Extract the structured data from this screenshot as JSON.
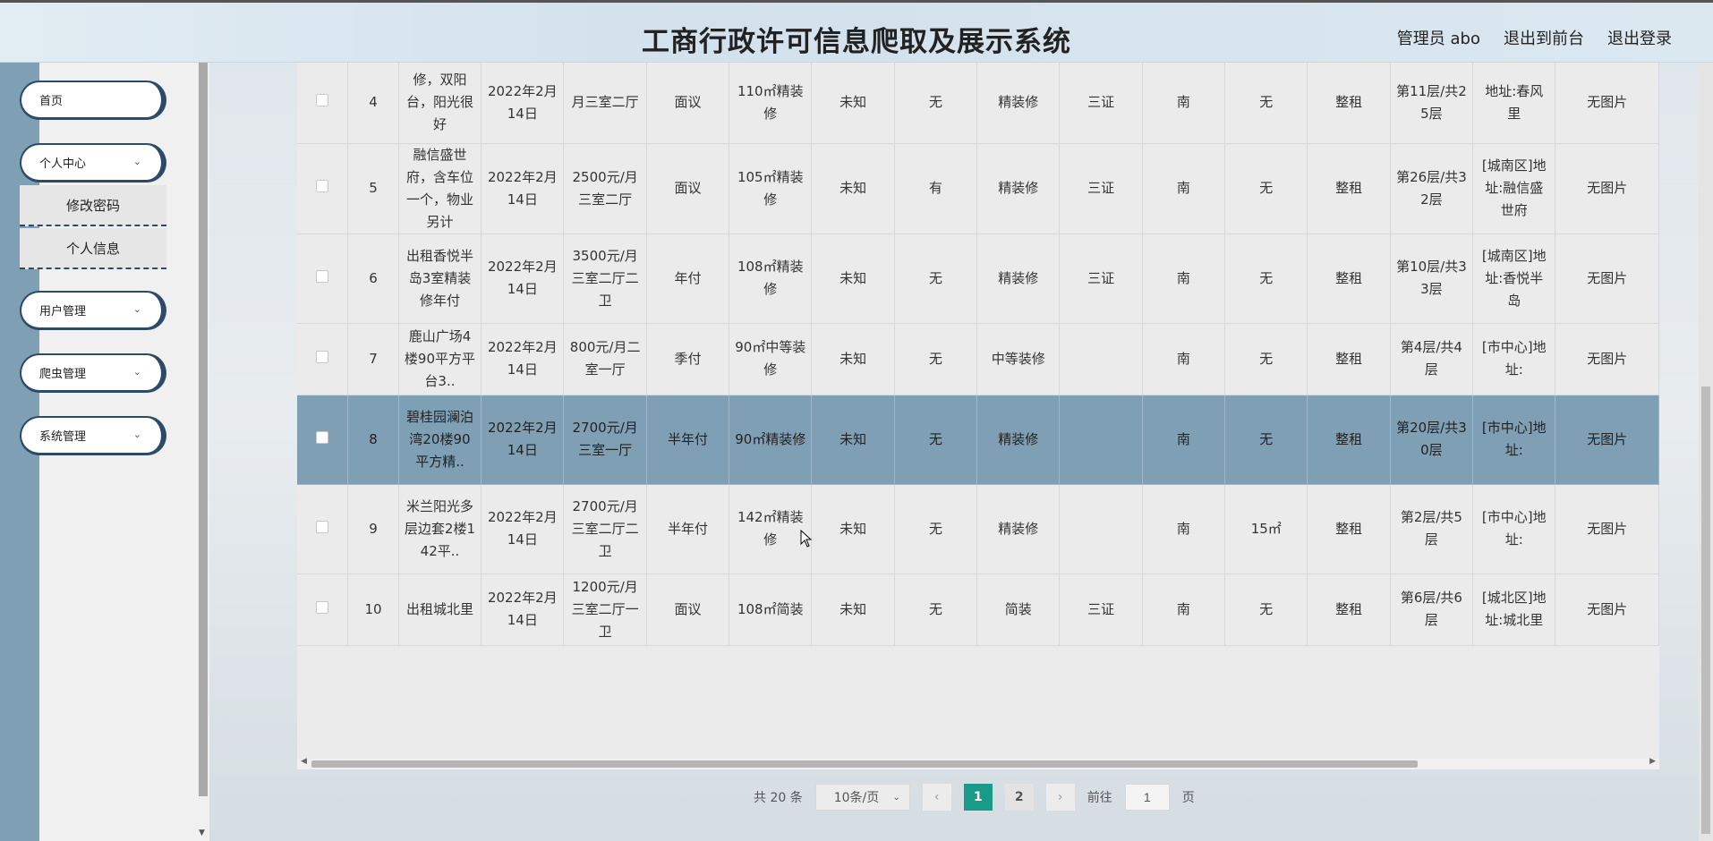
{
  "header": {
    "title": "工商行政许可信息爬取及展示系统",
    "user_label": "管理员 abo",
    "to_front_label": "退出到前台",
    "logout_label": "退出登录"
  },
  "sidebar": {
    "home": "首页",
    "personal_center": "个人中心",
    "change_password": "修改密码",
    "personal_info": "个人信息",
    "user_mgmt": "用户管理",
    "crawler_mgmt": "爬虫管理",
    "system_mgmt": "系统管理"
  },
  "rows": [
    {
      "no": "4",
      "title": "修，双阳台，阳光很好",
      "date": "2022年2月14日",
      "price": "月三室二厅",
      "pay": "面议",
      "area": "110㎡精装修",
      "c1": "未知",
      "c2": "无",
      "deco": "精装修",
      "cert": "三证",
      "dir": "南",
      "c3": "无",
      "rent": "整租",
      "floor": "第11层/共25层",
      "addr": "地址:春风里",
      "img": "无图片"
    },
    {
      "no": "5",
      "title": "融信盛世府，含车位一个，物业另计",
      "date": "2022年2月14日",
      "price": "2500元/月三室二厅",
      "pay": "面议",
      "area": "105㎡精装修",
      "c1": "未知",
      "c2": "有",
      "deco": "精装修",
      "cert": "三证",
      "dir": "南",
      "c3": "无",
      "rent": "整租",
      "floor": "第26层/共32层",
      "addr": "[城南区]地址:融信盛世府",
      "img": "无图片"
    },
    {
      "no": "6",
      "title": "出租香悦半岛3室精装修年付",
      "date": "2022年2月14日",
      "price": "3500元/月三室二厅二卫",
      "pay": "年付",
      "area": "108㎡精装修",
      "c1": "未知",
      "c2": "无",
      "deco": "精装修",
      "cert": "三证",
      "dir": "南",
      "c3": "无",
      "rent": "整租",
      "floor": "第10层/共33层",
      "addr": "[城南区]地址:香悦半岛",
      "img": "无图片"
    },
    {
      "no": "7",
      "title": "鹿山广场4楼90平方平台3..",
      "date": "2022年2月14日",
      "price": "800元/月二室一厅",
      "pay": "季付",
      "area": "90㎡中等装修",
      "c1": "未知",
      "c2": "无",
      "deco": "中等装修",
      "cert": "",
      "dir": "南",
      "c3": "无",
      "rent": "整租",
      "floor": "第4层/共4层",
      "addr": "[市中心]地址:",
      "img": "无图片"
    },
    {
      "no": "8",
      "title": "碧桂园澜泊湾20楼90平方精..",
      "date": "2022年2月14日",
      "price": "2700元/月三室一厅",
      "pay": "半年付",
      "area": "90㎡精装修",
      "c1": "未知",
      "c2": "无",
      "deco": "精装修",
      "cert": "",
      "dir": "南",
      "c3": "无",
      "rent": "整租",
      "floor": "第20层/共30层",
      "addr": "[市中心]地址:",
      "img": "无图片"
    },
    {
      "no": "9",
      "title": "米兰阳光多层边套2楼142平..",
      "date": "2022年2月14日",
      "price": "2700元/月三室二厅二卫",
      "pay": "半年付",
      "area": "142㎡精装修",
      "c1": "未知",
      "c2": "无",
      "deco": "精装修",
      "cert": "",
      "dir": "南",
      "c3": "15㎡",
      "rent": "整租",
      "floor": "第2层/共5层",
      "addr": "[市中心]地址:",
      "img": "无图片"
    },
    {
      "no": "10",
      "title": "出租城北里",
      "date": "2022年2月14日",
      "price": "1200元/月三室二厅一卫",
      "pay": "面议",
      "area": "108㎡简装",
      "c1": "未知",
      "c2": "无",
      "deco": "简装",
      "cert": "三证",
      "dir": "南",
      "c3": "无",
      "rent": "整租",
      "floor": "第6层/共6层",
      "addr": "[城北区]地址:城北里",
      "img": "无图片"
    }
  ],
  "pager": {
    "total": "共 20 条",
    "page_size": "10条/页",
    "page1": "1",
    "page2": "2",
    "goto_label": "前往",
    "goto_value": "1",
    "page_unit": "页"
  }
}
